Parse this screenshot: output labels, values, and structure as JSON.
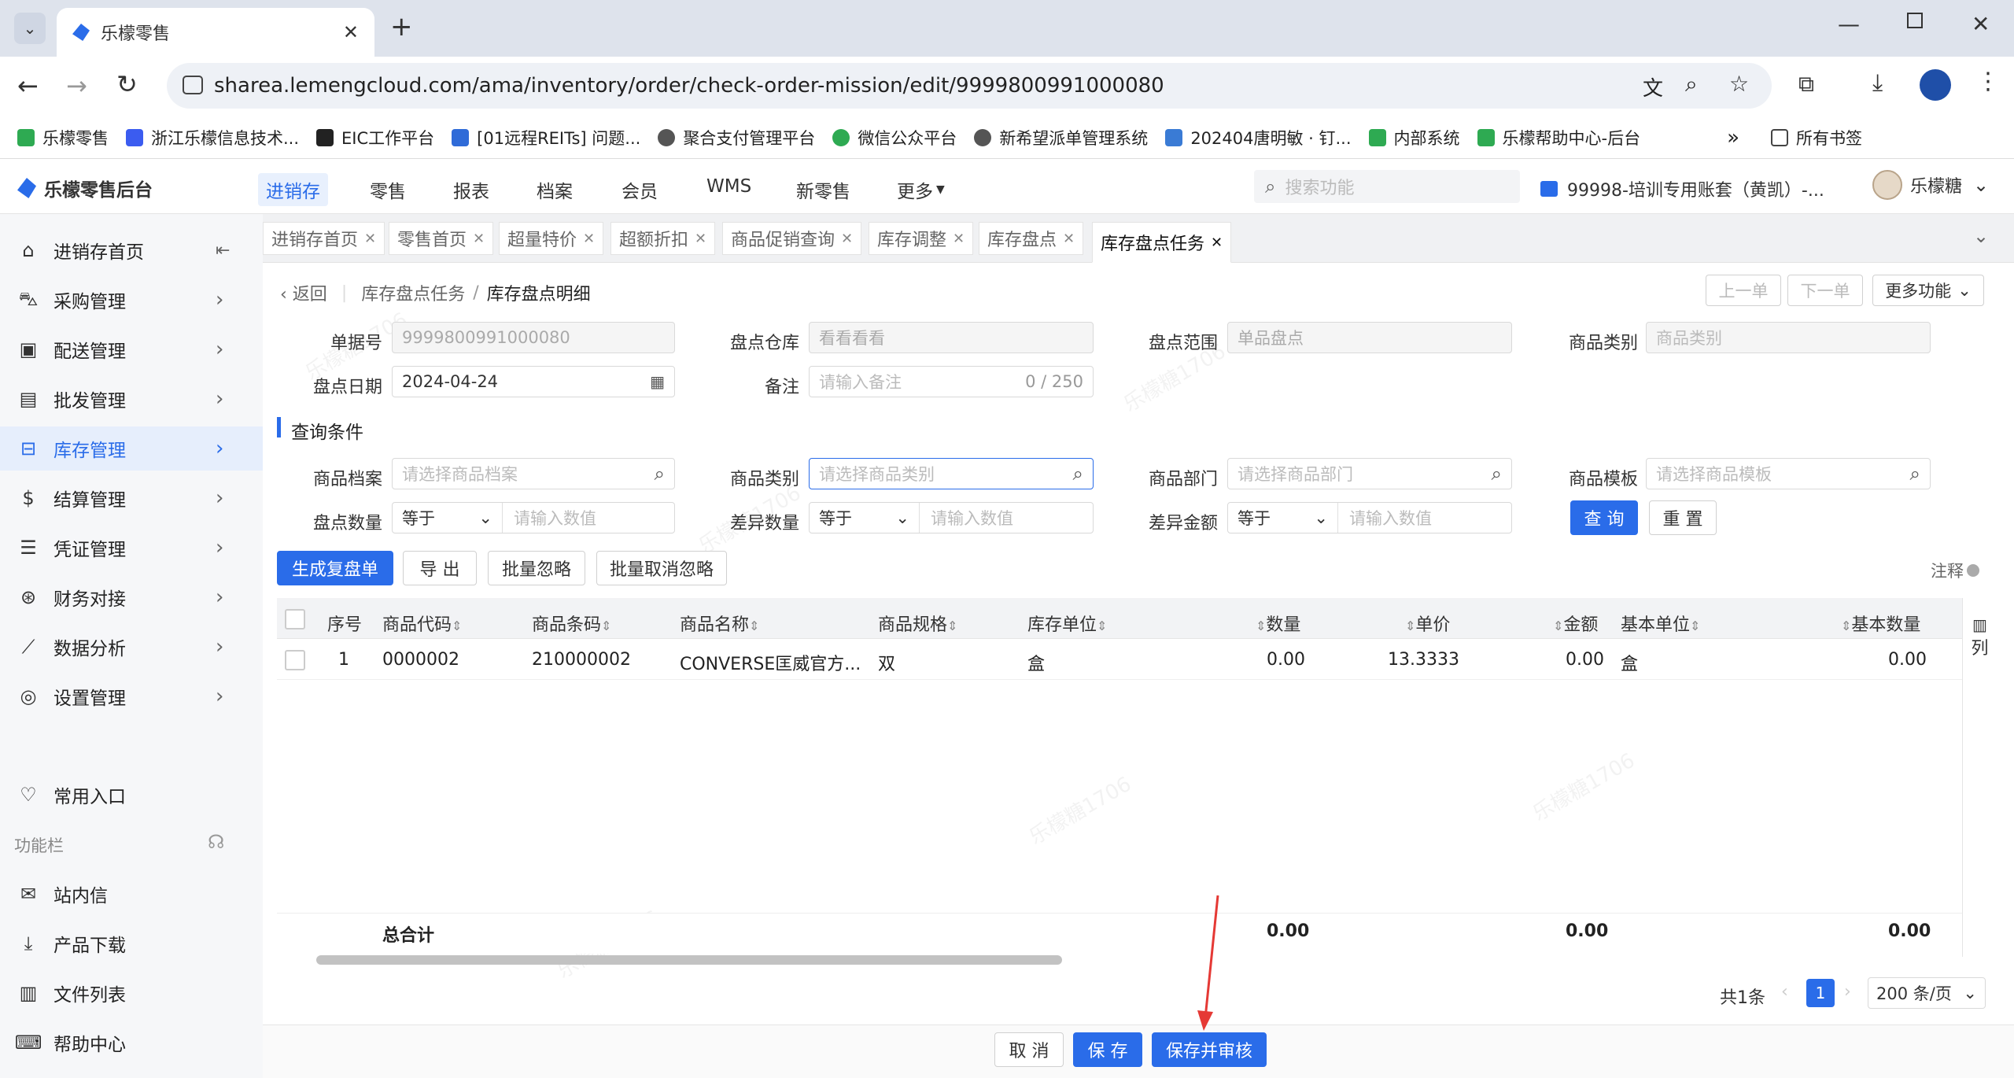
{
  "browser": {
    "tab_title": "乐檬零售",
    "url": "sharea.lemengcloud.com/ama/inventory/order/check-order-mission/edit/9999800991000080",
    "bookmarks": [
      "乐檬零售",
      "浙江乐檬信息技术...",
      "EIC工作平台",
      "[01远程REITs] 问题...",
      "聚合支付管理平台",
      "微信公众平台",
      "新希望派单管理系统",
      "202404唐明敏 · 钉...",
      "内部系统",
      "乐檬帮助中心-后台"
    ],
    "all_bookmarks": "所有书签"
  },
  "app": {
    "logo": "乐檬零售后台",
    "nav": [
      "进销存",
      "零售",
      "报表",
      "档案",
      "会员",
      "WMS",
      "新零售",
      "更多"
    ],
    "search_placeholder": "搜索功能",
    "account": "99998-培训专用账套（黄凯）-...",
    "user": "乐檬糖",
    "watermark": "乐檬糖1706"
  },
  "sidebar": {
    "items": [
      "进销存首页",
      "采购管理",
      "配送管理",
      "批发管理",
      "库存管理",
      "结算管理",
      "凭证管理",
      "财务对接",
      "数据分析",
      "设置管理"
    ],
    "common": "常用入口",
    "func_title": "功能栏",
    "func_items": [
      "站内信",
      "产品下载",
      "文件列表",
      "帮助中心"
    ]
  },
  "page_tabs": [
    "进销存首页",
    "零售首页",
    "超量特价",
    "超额折扣",
    "商品促销查询",
    "库存调整",
    "库存盘点",
    "库存盘点任务"
  ],
  "breadcrumb": {
    "back": "返回",
    "parent": "库存盘点任务",
    "sep": "/",
    "current": "库存盘点明细"
  },
  "top_buttons": {
    "prev": "上一单",
    "next": "下一单",
    "more": "更多功能"
  },
  "form": {
    "order_no_label": "单据号",
    "order_no": "9999800991000080",
    "warehouse_label": "盘点仓库",
    "warehouse": "看看看看",
    "range_label": "盘点范围",
    "range": "单品盘点",
    "category_label": "商品类别",
    "category_placeholder": "商品类别",
    "date_label": "盘点日期",
    "date": "2024-04-24",
    "remark_label": "备注",
    "remark_placeholder": "请输入备注",
    "remark_count": "0 / 250"
  },
  "query": {
    "title": "查询条件",
    "goods_label": "商品档案",
    "goods_placeholder": "请选择商品档案",
    "cat_label": "商品类别",
    "cat_placeholder": "请选择商品类别",
    "dept_label": "商品部门",
    "dept_placeholder": "请选择商品部门",
    "tpl_label": "商品模板",
    "tpl_placeholder": "请选择商品模板",
    "qty_label": "盘点数量",
    "diff_qty_label": "差异数量",
    "diff_amt_label": "差异金额",
    "op": "等于",
    "num_placeholder": "请输入数值",
    "search_btn": "查 询",
    "reset_btn": "重 置"
  },
  "actions": {
    "gen": "生成复盘单",
    "export": "导 出",
    "ignore": "批量忽略",
    "unignore": "批量取消忽略",
    "note": "注释"
  },
  "table": {
    "headers": [
      "序号",
      "商品代码",
      "商品条码",
      "商品名称",
      "商品规格",
      "库存单位",
      "数量",
      "单价",
      "金额",
      "基本单位",
      "基本数量"
    ],
    "col_btn": "列",
    "rows": [
      {
        "idx": "1",
        "code": "0000002",
        "barcode": "210000002",
        "name": "CONVERSE匡威官方...",
        "spec": "双",
        "unit": "盒",
        "qty": "0.00",
        "price": "13.3333",
        "amount": "0.00",
        "base_unit": "盒",
        "base_qty": "0.00"
      }
    ],
    "total_label": "总合计",
    "total_qty": "0.00",
    "total_amount": "0.00",
    "total_base_qty": "0.00"
  },
  "pagination": {
    "total": "共1条",
    "page": "1",
    "size": "200 条/页"
  },
  "footer": {
    "cancel": "取 消",
    "save": "保 存",
    "save_audit": "保存并审核"
  }
}
